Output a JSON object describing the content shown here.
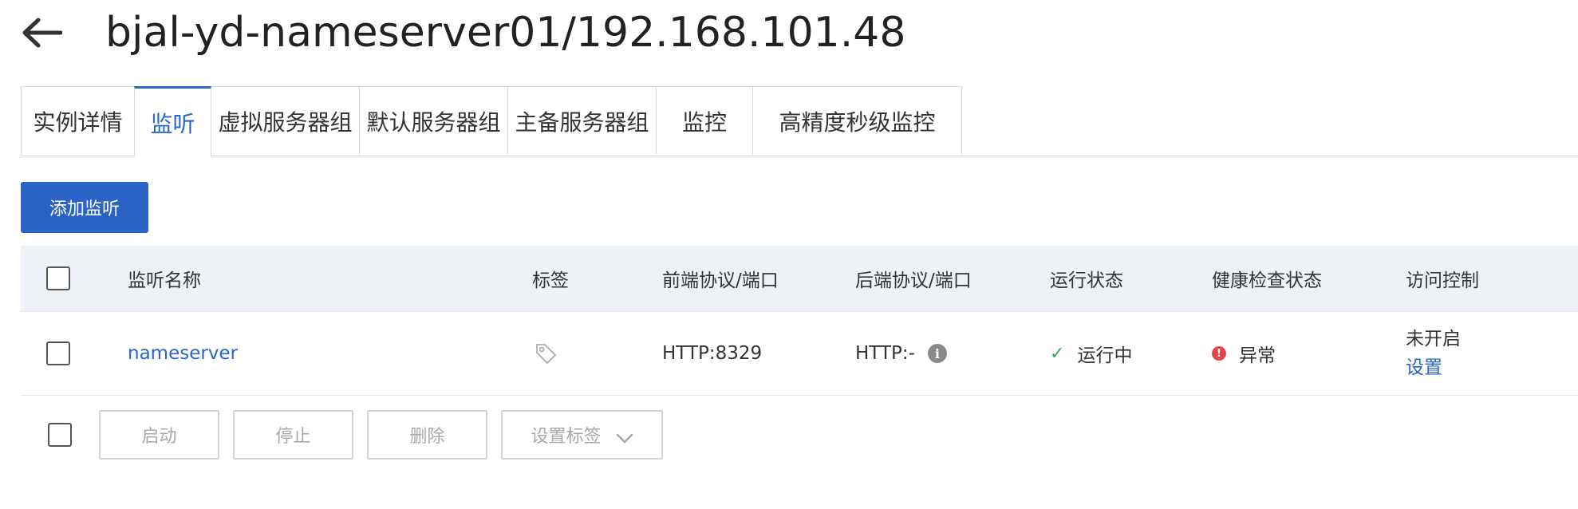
{
  "header": {
    "title": "bjal-yd-nameserver01/192.168.101.48"
  },
  "tabs": [
    {
      "label": "实例详情",
      "active": false
    },
    {
      "label": "监听",
      "active": true
    },
    {
      "label": "虚拟服务器组",
      "active": false
    },
    {
      "label": "默认服务器组",
      "active": false
    },
    {
      "label": "主备服务器组",
      "active": false
    },
    {
      "label": "监控",
      "active": false
    },
    {
      "label": "高精度秒级监控",
      "active": false
    }
  ],
  "toolbar": {
    "add_listener_label": "添加监听"
  },
  "table": {
    "columns": [
      "监听名称",
      "标签",
      "前端协议/端口",
      "后端协议/端口",
      "运行状态",
      "健康检查状态",
      "访问控制"
    ],
    "rows": [
      {
        "name": "nameserver",
        "frontend": "HTTP:8329",
        "backend": "HTTP:-",
        "run_status": "运行中",
        "health_status": "异常",
        "acl_status": "未开启",
        "acl_action": "设置"
      }
    ]
  },
  "bulk_actions": {
    "start": "启动",
    "stop": "停止",
    "delete": "删除",
    "set_tags": "设置标签"
  },
  "colors": {
    "accent": "#2866c8",
    "primary_button": "#2a62c5",
    "header_bg": "#eef1f6",
    "ok": "#3aa35a",
    "error": "#e04848"
  },
  "icons": {
    "back": "arrow-left-icon",
    "tag": "tag-icon",
    "info": "info-icon",
    "ok": "check-icon",
    "error": "alert-circle-icon",
    "dropdown": "chevron-down-icon"
  }
}
